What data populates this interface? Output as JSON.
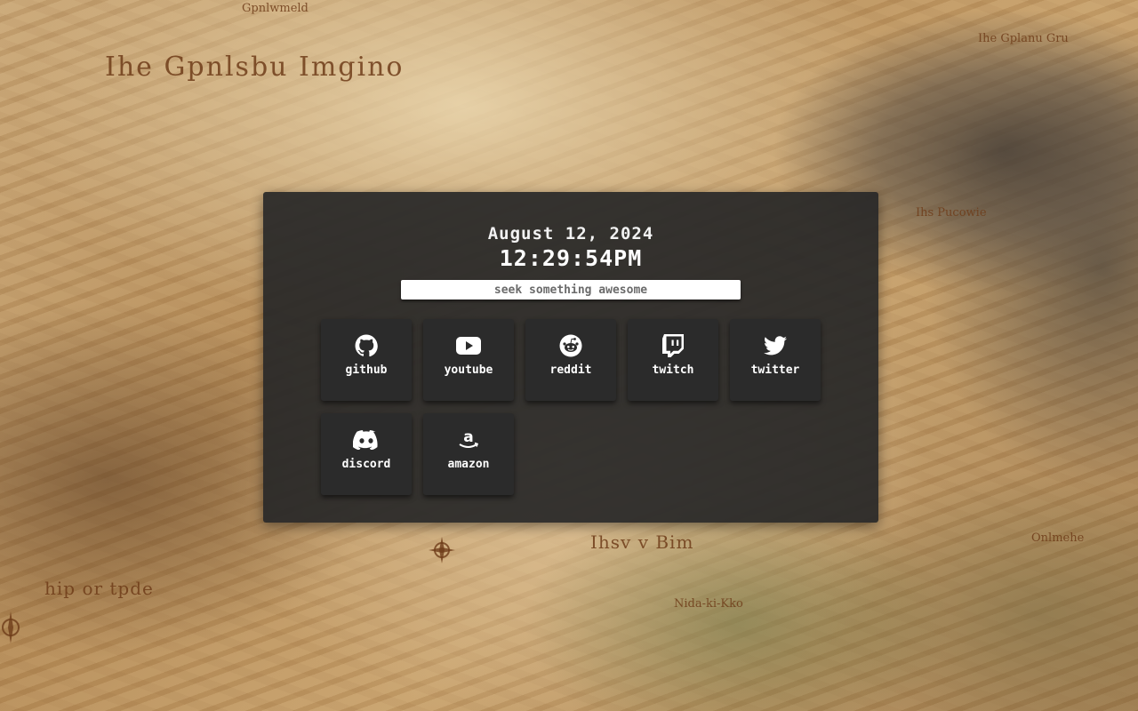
{
  "background": {
    "labels": [
      "Ihe Gpnlsbu Imgino",
      "Gpnlwmeld",
      "Ihe Gplanu Gru",
      "Ihs Pucowie",
      "Ihsv v Bim",
      "Nida-ki-Kko",
      "Onlmehe",
      "hip or tpde"
    ]
  },
  "clock": {
    "date": "August 12, 2024",
    "time": "12:29:54PM"
  },
  "search": {
    "placeholder": "seek something awesome",
    "value": ""
  },
  "links": [
    {
      "label": "github",
      "icon": "github-icon"
    },
    {
      "label": "youtube",
      "icon": "youtube-icon"
    },
    {
      "label": "reddit",
      "icon": "reddit-icon"
    },
    {
      "label": "twitch",
      "icon": "twitch-icon"
    },
    {
      "label": "twitter",
      "icon": "twitter-icon"
    },
    {
      "label": "discord",
      "icon": "discord-icon"
    },
    {
      "label": "amazon",
      "icon": "amazon-icon"
    }
  ],
  "colors": {
    "panel": "#2e2e2e",
    "tile": "#2b2b2b",
    "text": "#ffffff"
  }
}
